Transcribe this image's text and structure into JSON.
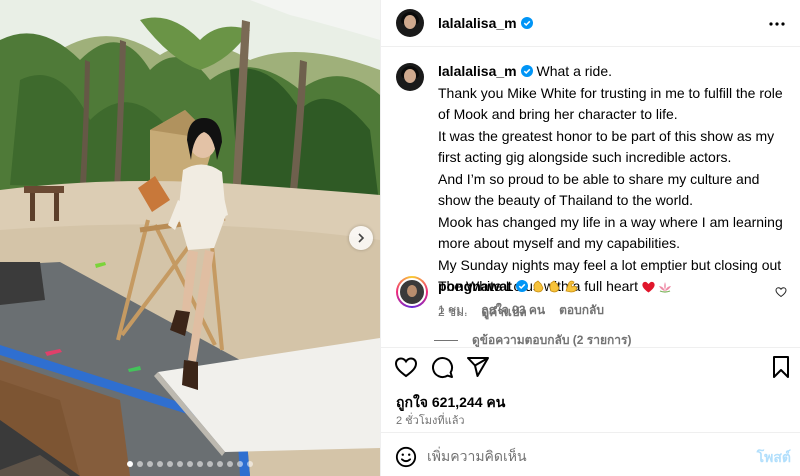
{
  "post": {
    "username": "lalalalisa_m",
    "more_icon": "more-horizontal-icon",
    "verified_color": "#0095f6"
  },
  "caption": {
    "username": "lalalalisa_m",
    "lines": [
      "What a ride.",
      "Thank you Mike White for trusting in me to fulfill the role of Mook and bring her character to life.",
      "It was the greatest honor to be part of this show as my first acting gig alongside such incredible actors.",
      "And I’m so proud to be able to share my culture and show the beauty of Thailand to the world.",
      "Mook has changed my life in a way where I am learning more about myself and my capabilities.",
      "My Sunday nights may feel a lot emptier but closing out The White Lotus with a full heart"
    ],
    "emojis": [
      "red-heart-icon",
      "lotus-icon"
    ],
    "time": "2 ชม.",
    "translate": "ดูคำแปล"
  },
  "comment": {
    "username": "pongnawat",
    "emojis": [
      "clapping-hands-icon",
      "clapping-hands-icon",
      "flexed-biceps-icon"
    ],
    "time": "1 ชม.",
    "likes": "ถูกใจ 93 คน",
    "reply": "ตอบกลับ",
    "view_replies": "ดูข้อความตอบกลับ (2 รายการ)"
  },
  "actions": {
    "icons": [
      "heart-icon",
      "comment-icon",
      "share-icon",
      "save-icon"
    ]
  },
  "likes_text": "ถูกใจ 621,244 คน",
  "posted_time": "2 ชั่วโมงที่แล้ว",
  "add_comment": {
    "placeholder": "เพิ่มความคิดเห็น",
    "post_label": "โพสต์"
  },
  "carousel": {
    "active_index": 0,
    "count": 13
  },
  "colors": {
    "accent": "#0095f6",
    "secondary_text": "#737373",
    "post_button_disabled": "#b2dffc",
    "border": "#efefef"
  }
}
